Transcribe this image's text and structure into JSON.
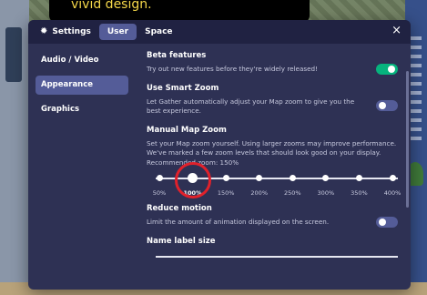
{
  "tooltip": {
    "text": "vivid design."
  },
  "tabs": [
    {
      "label": "Settings",
      "icon": "gear-icon"
    },
    {
      "label": "User",
      "active": true
    },
    {
      "label": "Space"
    }
  ],
  "close_icon": "×",
  "sidebar": {
    "items": [
      {
        "label": "Audio / Video"
      },
      {
        "label": "Appearance",
        "active": true
      },
      {
        "label": "Graphics"
      }
    ]
  },
  "sections": {
    "beta": {
      "title": "Beta features",
      "desc": "Try out new features before they're widely released!",
      "toggle": "on"
    },
    "smart_zoom": {
      "title": "Use Smart Zoom",
      "desc": "Let Gather automatically adjust your Map zoom to give you the best experience.",
      "toggle": "off"
    },
    "manual_zoom": {
      "title": "Manual Map Zoom",
      "desc": "Set your Map zoom yourself. Using larger zooms may improve performance. We've marked a few zoom levels that should look good on your display. Recommended zoom: 150%",
      "levels": [
        "50%",
        "100%",
        "150%",
        "200%",
        "250%",
        "300%",
        "350%",
        "400%"
      ],
      "selected_index": 1
    },
    "reduce_motion": {
      "title": "Reduce motion",
      "desc": "Limit the amount of animation displayed on the screen.",
      "toggle": "off"
    },
    "name_label": {
      "title": "Name label size"
    }
  },
  "colors": {
    "modal_bg": "#2e3154",
    "tabbar_bg": "#202242",
    "accent": "#545c98",
    "toggle_on": "#06b37d",
    "highlight": "#e0212b"
  }
}
